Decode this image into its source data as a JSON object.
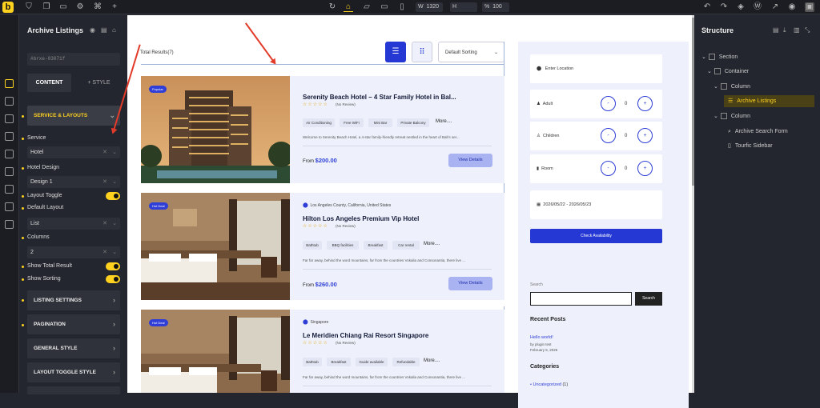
{
  "toolbar": {
    "logo": "b",
    "width_label": "W",
    "width_value": "1320",
    "height_label": "H",
    "percent_label": "%",
    "zoom_value": "100"
  },
  "left_panel": {
    "title": "Archive Listings",
    "element_id": "#brxe-03071f",
    "tab_content": "CONTENT",
    "tab_style": "+ STYLE",
    "section_service_layouts": "SERVICE & LAYOUTS",
    "service_label": "Service",
    "service_value": "Hotel",
    "hotel_design_label": "Hotel Design",
    "hotel_design_value": "Design 1",
    "layout_toggle_label": "Layout Toggle",
    "default_layout_label": "Default Layout",
    "default_layout_value": "List",
    "columns_label": "Columns",
    "columns_value": "2",
    "show_total_label": "Show Total Result",
    "show_sorting_label": "Show Sorting",
    "sections": [
      "LISTING SETTINGS",
      "PAGINATION",
      "GENERAL STYLE",
      "LAYOUT TOGGLE STYLE"
    ]
  },
  "canvas": {
    "total_results": "Total Results(7)",
    "sorting": "Default Sorting",
    "cards": [
      {
        "badge": "Popular",
        "location": "",
        "title": "Serenity Beach Hotel – 4 Star Family Hotel in Bal...",
        "review": "(No Review)",
        "features": [
          "Air Conditioning",
          "Free WiFi",
          "Mini Bar",
          "Private Balcony"
        ],
        "more": "More....",
        "desc": "Welcome to Serenity Beach Hotel, a 4-star family-friendly retreat nestled in the heart of Bali's ser...",
        "price_prefix": "From",
        "price": "$200.00",
        "btn": "View Details"
      },
      {
        "badge": "Hot Deal",
        "location": "Los Angeles County, California, United States",
        "title": "Hilton Los Angeles Premium Vip Hotel",
        "review": "(No Review)",
        "features": [
          "Bathtub",
          "BBQ facilities",
          "Breakfast",
          "Car rental"
        ],
        "more": "More....",
        "desc": "Far far away, behind the word mountains, far from the countries Vokalia and Consonantia, there live ...",
        "price_prefix": "From",
        "price": "$260.00",
        "btn": "View Details"
      },
      {
        "badge": "Hot Deal",
        "location": "Singapore",
        "title": "Le Meridien Chiang Rai Resort Singapore",
        "review": "(No Review)",
        "features": [
          "Bathtub",
          "Breakfast",
          "Guide available",
          "Refundable"
        ],
        "more": "More....",
        "desc": "Far far away, behind the word mountains, far from the countries Vokalia and Consonantia, there live ..."
      }
    ],
    "search_form": {
      "location_placeholder": "Enter Location",
      "adult_label": "Adult",
      "adult_value": "0",
      "children_label": "Children",
      "children_value": "0",
      "room_label": "Room",
      "room_value": "0",
      "dates": "2026/05/22 - 2026/05/23",
      "button": "Check Availability"
    },
    "sidebar": {
      "search_label": "Search",
      "search_button": "Search",
      "recent_posts_heading": "Recent Posts",
      "post_title": "Hello world!",
      "post_author": "by plugin test",
      "post_date": "February 5, 2026",
      "categories_heading": "Categories",
      "category": "Uncategorized",
      "category_count": "(1)"
    }
  },
  "structure": {
    "title": "Structure",
    "nodes": [
      "Section",
      "Container",
      "Column",
      "Archive Listings",
      "Column",
      "Archive Search Form",
      "Tourfic Sidebar"
    ]
  },
  "colors": {
    "accent": "#ffd21f",
    "brand_blue": "#2e3ed6",
    "arrow_red": "#e23b2a"
  },
  "icons": [
    "bricks-logo",
    "shield-icon",
    "copy-icon",
    "folder-icon",
    "gear-icon",
    "command-icon",
    "plus-icon",
    "refresh-icon",
    "desktop-icon",
    "tablet-icon",
    "mobile-icon",
    "undo-icon",
    "redo-icon",
    "database-icon",
    "wordpress-icon",
    "external-link-icon",
    "eye-icon",
    "save-icon"
  ]
}
